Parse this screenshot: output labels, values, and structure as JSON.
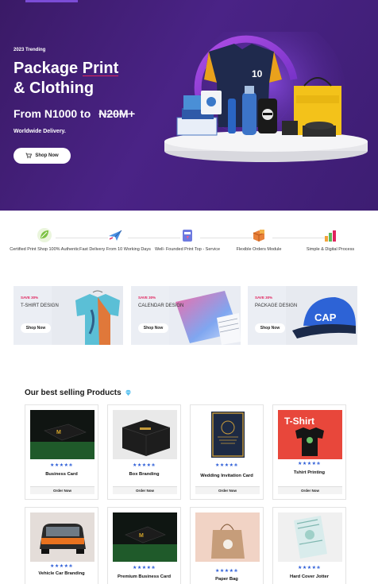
{
  "hero": {
    "tag": "2023 Trending",
    "title_line1_a": "Package ",
    "title_line1_b": "Print",
    "title_line2": "& Clothing",
    "price_from": "From N1000 to",
    "price_strike": "N20M+",
    "subtitle": "Worldwide Delivery.",
    "shop_button": "Shop Now",
    "shirt_number": "10",
    "colors": {
      "bg": "#3f1f74",
      "accent": "#e0245e"
    }
  },
  "features": [
    {
      "icon": "leaf-badge-icon",
      "text": "Certified Print Shop 100% Authentic"
    },
    {
      "icon": "airplane-icon",
      "text": "Fast Delivery From 10 Working Days"
    },
    {
      "icon": "print-tag-icon",
      "text": "Well- Founded Print Top - Service"
    },
    {
      "icon": "box-icon",
      "text": "Flexible Orders Module"
    },
    {
      "icon": "bar-chart-icon",
      "text": "Simple & Digital Process"
    }
  ],
  "categories": [
    {
      "save": "SAVE 30%",
      "title": "T-SHIRT DESIGN",
      "button": "Shop Now"
    },
    {
      "save": "SAVE 30%",
      "title": "CALENDAR DESIGN",
      "button": "Shop Now"
    },
    {
      "save": "SAVE 30%",
      "title": "PACKAGE DESIGN",
      "button": "Shop Now",
      "art_text": "CAP"
    }
  ],
  "best_selling": {
    "title": "Our best selling Products",
    "products": [
      {
        "name": "Business Card",
        "rating": "★★★★✬",
        "button": "Order Now"
      },
      {
        "name": "Box Branding",
        "rating": "★★★★✬",
        "button": "Order Now"
      },
      {
        "name": "Wedding Invitation Card",
        "rating": "★★★★✬",
        "button": "Order Now"
      },
      {
        "name": "Tshirt Printing",
        "rating": "★★★★✬",
        "button": "Order Now",
        "art_text": "T-Shirt"
      },
      {
        "name": "Vehicle Car Branding",
        "rating": "★★★★✬"
      },
      {
        "name": "Premium Business Card",
        "rating": "★★★★✬"
      },
      {
        "name": "Paper Bag",
        "rating": "★★★★✬"
      },
      {
        "name": "Hard Cover Jotter",
        "rating": "★★★★✬"
      }
    ]
  }
}
